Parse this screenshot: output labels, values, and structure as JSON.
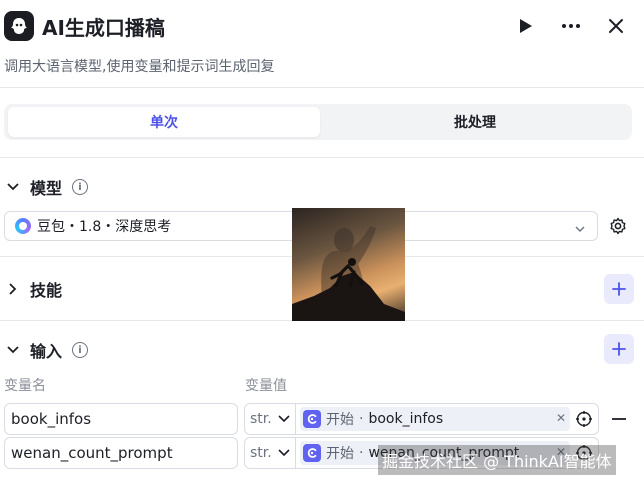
{
  "header": {
    "title": "AI生成口播稿",
    "description": "调用大语言模型,使用变量和提示词生成回复"
  },
  "tabs": [
    {
      "label": "单次",
      "active": true
    },
    {
      "label": "批处理",
      "active": false
    }
  ],
  "model": {
    "section_title": "模型",
    "selected": "豆包・1.8・深度思考"
  },
  "skills": {
    "section_title": "技能"
  },
  "input": {
    "section_title": "输入",
    "col_name": "变量名",
    "col_value": "变量值",
    "rows": [
      {
        "name": "book_infos",
        "type": "str.",
        "ref_source": "开始",
        "ref_var": "book_infos"
      },
      {
        "name": "wenan_count_prompt",
        "type": "str.",
        "ref_source": "开始",
        "ref_var": "wenan_count_prompt"
      }
    ]
  },
  "watermark": "掘金技术社区 @ ThinkAI智能体",
  "colors": {
    "accent": "#4d53e8",
    "accent_bg": "#e9ebfd",
    "border": "#d9dce3"
  },
  "icons": {
    "app": "robot-icon",
    "run": "play-icon",
    "more": "more-icon",
    "close": "close-icon",
    "settings": "gear-icon",
    "info": "info-icon"
  }
}
